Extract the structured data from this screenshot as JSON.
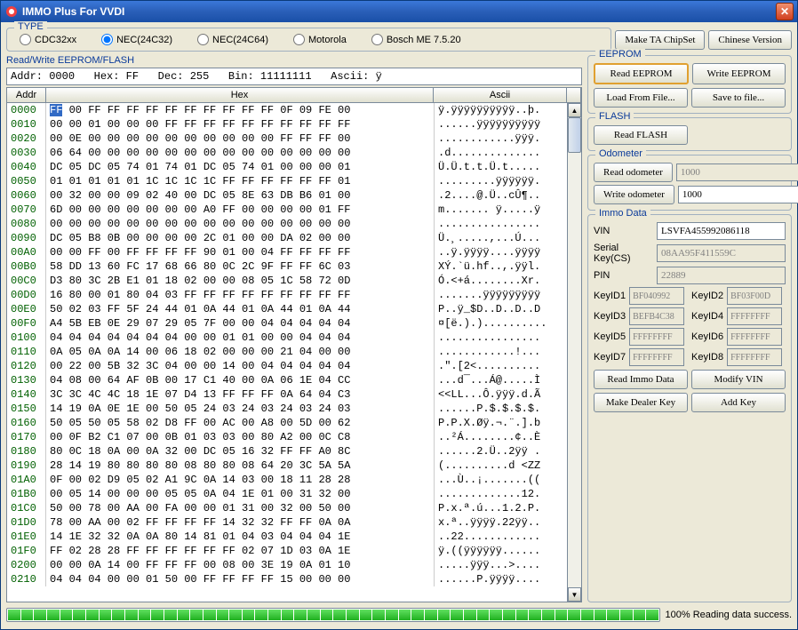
{
  "title": "IMMO Plus For VVDI",
  "type_label": "TYPE",
  "radios": [
    {
      "label": "CDC32xx",
      "checked": false
    },
    {
      "label": "NEC(24C32)",
      "checked": true
    },
    {
      "label": "NEC(24C64)",
      "checked": false
    },
    {
      "label": "Motorola",
      "checked": false
    },
    {
      "label": "Bosch ME 7.5.20",
      "checked": false
    }
  ],
  "top_buttons": {
    "make_ta": "Make TA ChipSet",
    "lang": "Chinese Version"
  },
  "rw_label": "Read/Write EEPROM/FLASH",
  "status": {
    "addr_l": "Addr:",
    "addr_v": "0000",
    "hex_l": "Hex:",
    "hex_v": "FF",
    "dec_l": "Dec:",
    "dec_v": "255",
    "bin_l": "Bin:",
    "bin_v": "11111111",
    "asc_l": "Ascii:",
    "asc_v": "ÿ"
  },
  "col_addr": "Addr",
  "col_hex": "Hex",
  "col_ascii": "Ascii",
  "hex_rows": [
    {
      "a": "0000",
      "h": "FF 00 FF FF FF FF FF FF FF FF FF FF 0F 09 FE 00",
      "s": "ÿ.ÿÿÿÿÿÿÿÿÿÿ..þ.",
      "hl": true
    },
    {
      "a": "0010",
      "h": "00 00 01 00 00 00 FF FF FF FF FF FF FF FF FF FF",
      "s": "......ÿÿÿÿÿÿÿÿÿÿ"
    },
    {
      "a": "0020",
      "h": "00 0E 00 00 00 00 00 00 00 00 00 00 FF FF FF 00",
      "s": "............ÿÿÿ."
    },
    {
      "a": "0030",
      "h": "06 64 00 00 00 00 00 00 00 00 00 00 00 00 00 00",
      "s": ".d.............."
    },
    {
      "a": "0040",
      "h": "DC 05 DC 05 74 01 74 01 DC 05 74 01 00 00 00 01",
      "s": "Ü.Ü.t.t.Ü.t....."
    },
    {
      "a": "0050",
      "h": "01 01 01 01 01 1C 1C 1C 1C FF FF FF FF FF FF 01",
      "s": ".........ÿÿÿÿÿÿ."
    },
    {
      "a": "0060",
      "h": "00 32 00 00 09 02 40 00 DC 05 8E 63 DB B6 01 00",
      "s": ".2....@.Ü..cÛ¶.."
    },
    {
      "a": "0070",
      "h": "6D 00 00 00 00 00 00 00 A0 FF 00 00 00 00 01 FF",
      "s": "m....... ÿ.....ÿ"
    },
    {
      "a": "0080",
      "h": "00 00 00 00 00 00 00 00 00 00 00 00 00 00 00 00",
      "s": "................"
    },
    {
      "a": "0090",
      "h": "DC 05 B8 0B 00 00 00 00 2C 01 00 00 DA 02 00 00",
      "s": "Ü.¸.....,...Ú..."
    },
    {
      "a": "00A0",
      "h": "00 00 FF 00 FF FF FF FF 90 01 00 04 FF FF FF FF",
      "s": "..ÿ.ÿÿÿÿ....ÿÿÿÿ"
    },
    {
      "a": "00B0",
      "h": "58 DD 13 60 FC 17 68 66 80 0C 2C 9F FF FF 6C 03",
      "s": "XÝ.`ü.hf..,.ÿÿl."
    },
    {
      "a": "00C0",
      "h": "D3 80 3C 2B E1 01 18 02 00 00 08 05 1C 58 72 0D",
      "s": "Ó.<+á........Xr."
    },
    {
      "a": "00D0",
      "h": "16 80 00 01 80 04 03 FF FF FF FF FF FF FF FF FF",
      "s": ".......ÿÿÿÿÿÿÿÿÿ"
    },
    {
      "a": "00E0",
      "h": "50 02 03 FF 5F 24 44 01 0A 44 01 0A 44 01 0A 44",
      "s": "P..ÿ_$D..D..D..D"
    },
    {
      "a": "00F0",
      "h": "A4 5B EB 0E 29 07 29 05 7F 00 00 04 04 04 04 04",
      "s": "¤[ë.).).........."
    },
    {
      "a": "0100",
      "h": "04 04 04 04 04 04 04 00 00 01 01 00 00 04 04 04",
      "s": "................"
    },
    {
      "a": "0110",
      "h": "0A 05 0A 0A 14 00 06 18 02 00 00 00 21 04 00 00",
      "s": "............!..."
    },
    {
      "a": "0120",
      "h": "00 22 00 5B 32 3C 04 00 00 14 00 04 04 04 04 04",
      "s": ".\".[2<.........."
    },
    {
      "a": "0130",
      "h": "04 08 00 64 AF 0B 00 17 C1 40 00 0A 06 1E 04 CC",
      "s": "...d¯...Á@.....Ì"
    },
    {
      "a": "0140",
      "h": "3C 3C 4C 4C 18 1E 07 D4 13 FF FF FF 0A 64 04 C3",
      "s": "<<LL...Ô.ÿÿÿ.d.Ã"
    },
    {
      "a": "0150",
      "h": "14 19 0A 0E 1E 00 50 05 24 03 24 03 24 03 24 03",
      "s": "......P.$.$.$.$."
    },
    {
      "a": "0160",
      "h": "50 05 50 05 58 02 D8 FF 00 AC 00 A8 00 5D 00 62",
      "s": "P.P.X.Øÿ.¬.¨.].b"
    },
    {
      "a": "0170",
      "h": "00 0F B2 C1 07 00 0B 01 03 03 00 80 A2 00 0C C8",
      "s": "..²Á........¢..È"
    },
    {
      "a": "0180",
      "h": "80 0C 18 0A 00 0A 32 00 DC 05 16 32 FF FF A0 8C",
      "s": "......2.Ü..2ÿÿ ."
    },
    {
      "a": "0190",
      "h": "28 14 19 80 80 80 80 08 80 80 08 64 20 3C 5A 5A",
      "s": "(..........d <ZZ"
    },
    {
      "a": "01A0",
      "h": "0F 00 02 D9 05 02 A1 9C 0A 14 03 00 18 11 28 28",
      "s": "...Ù..¡.......(("
    },
    {
      "a": "01B0",
      "h": "00 05 14 00 00 00 05 05 0A 04 1E 01 00 31 32 00",
      "s": ".............12."
    },
    {
      "a": "01C0",
      "h": "50 00 78 00 AA 00 FA 00 00 01 31 00 32 00 50 00",
      "s": "P.x.ª.ú...1.2.P."
    },
    {
      "a": "01D0",
      "h": "78 00 AA 00 02 FF FF FF FF 14 32 32 FF FF 0A 0A",
      "s": "x.ª..ÿÿÿÿ.22ÿÿ.."
    },
    {
      "a": "01E0",
      "h": "14 1E 32 32 0A 0A 80 14 81 01 04 03 04 04 04 1E",
      "s": "..22............"
    },
    {
      "a": "01F0",
      "h": "FF 02 28 28 FF FF FF FF FF FF 02 07 1D 03 0A 1E",
      "s": "ÿ.((ÿÿÿÿÿÿ......"
    },
    {
      "a": "0200",
      "h": "00 00 0A 14 00 FF FF FF 00 08 00 3E 19 0A 01 10",
      "s": ".....ÿÿÿ...>...."
    },
    {
      "a": "0210",
      "h": "04 04 04 00 00 01 50 00 FF FF FF FF 15 00 00 00",
      "s": "......P.ÿÿÿÿ...."
    }
  ],
  "eeprom": {
    "label": "EEPROM",
    "read": "Read EEPROM",
    "write": "Write EEPROM",
    "load": "Load From File...",
    "save": "Save to file..."
  },
  "flash": {
    "label": "FLASH",
    "read": "Read FLASH"
  },
  "odo": {
    "label": "Odometer",
    "read": "Read odometer",
    "write": "Write odometer",
    "read_val": "1000",
    "write_val": "1000"
  },
  "immo": {
    "label": "Immo Data",
    "vin_l": "VIN",
    "vin_v": "LSVFA455992086118",
    "sk_l": "Serial Key(CS)",
    "sk_v": "08AA95F411559C",
    "pin_l": "PIN",
    "pin_v": "22889",
    "k1l": "KeyID1",
    "k1v": "BF040992",
    "k2l": "KeyID2",
    "k2v": "BF03F00D",
    "k3l": "KeyID3",
    "k3v": "BEFB4C38",
    "k4l": "KeyID4",
    "k4v": "FFFFFFFF",
    "k5l": "KeyID5",
    "k5v": "FFFFFFFF",
    "k6l": "KeyID6",
    "k6v": "FFFFFFFF",
    "k7l": "KeyID7",
    "k7v": "FFFFFFFF",
    "k8l": "KeyID8",
    "k8v": "FFFFFFFF",
    "read": "Read Immo Data",
    "modify": "Modify VIN",
    "dealer": "Make Dealer Key",
    "add": "Add Key"
  },
  "progress": {
    "text": "100% Reading data success."
  }
}
